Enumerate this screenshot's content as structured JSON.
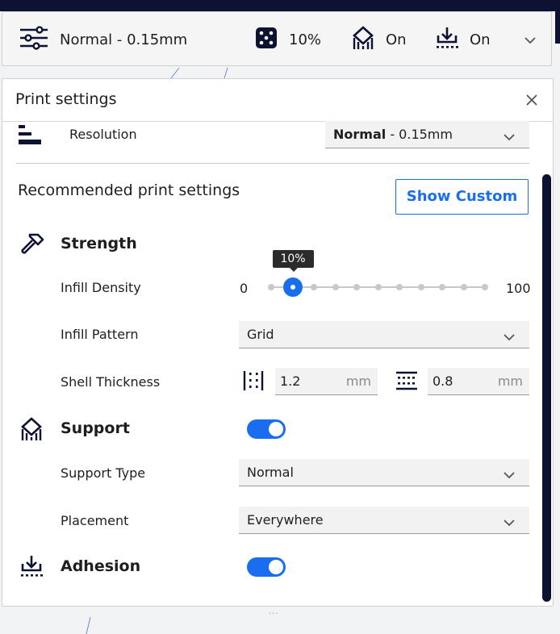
{
  "header": {
    "profile": "Normal - 0.15mm",
    "infill": "10%",
    "support": "On",
    "adhesion": "On"
  },
  "panel": {
    "title": "Print settings",
    "resolution_label": "Resolution",
    "resolution_value_bold": "Normal",
    "resolution_value_rest": " - 0.15mm",
    "recommended_title": "Recommended print settings",
    "show_custom_label": "Show Custom",
    "strength": {
      "title": "Strength",
      "infill_density_label": "Infill Density",
      "infill_min": "0",
      "infill_max": "100",
      "infill_value": 10,
      "infill_tooltip": "10%",
      "infill_pattern_label": "Infill Pattern",
      "infill_pattern_value": "Grid",
      "shell_thickness_label": "Shell Thickness",
      "wall_thickness": "1.2",
      "top_bottom_thickness": "0.8",
      "unit": "mm"
    },
    "support": {
      "title": "Support",
      "enabled": true,
      "type_label": "Support Type",
      "type_value": "Normal",
      "placement_label": "Placement",
      "placement_value": "Everywhere"
    },
    "adhesion": {
      "title": "Adhesion",
      "enabled": true
    }
  },
  "colors": {
    "accent": "#196ef0",
    "dark": "#0d1233",
    "field_bg": "#f2f2f2"
  },
  "icons": {
    "header": [
      "settings-sliders-icon",
      "infill-icon",
      "support-icon",
      "adhesion-icon",
      "chevron-down-icon"
    ],
    "panel": [
      "resolution-icon",
      "strength-hammer-icon",
      "support-icon",
      "adhesion-icon",
      "wall-thickness-icon",
      "top-bottom-thickness-icon",
      "close-icon"
    ]
  }
}
